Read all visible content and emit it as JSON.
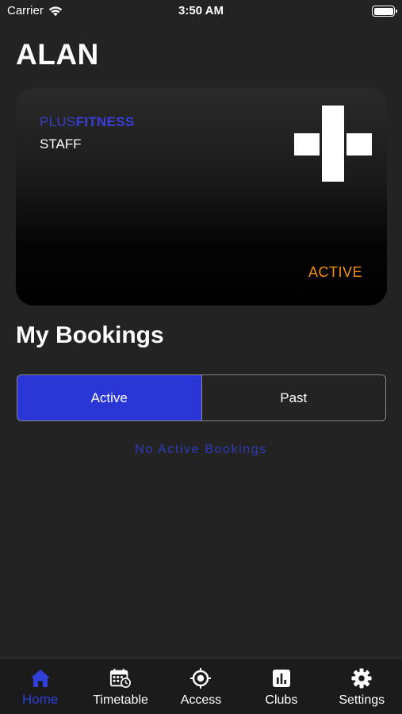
{
  "status_bar": {
    "carrier": "Carrier",
    "time": "3:50 AM"
  },
  "member": {
    "name": "ALAN"
  },
  "card": {
    "brand_plus": "PLUS",
    "brand_fitness": "FITNESS",
    "member_type": "STAFF",
    "status": "ACTIVE",
    "logo_icon": "plus-icon"
  },
  "bookings": {
    "title": "My Bookings",
    "tabs": [
      {
        "label": "Active",
        "selected": true
      },
      {
        "label": "Past",
        "selected": false
      }
    ],
    "empty_message": "No Active Bookings"
  },
  "tab_bar": {
    "items": [
      {
        "label": "Home",
        "icon": "home-icon",
        "selected": true
      },
      {
        "label": "Timetable",
        "icon": "calendar-icon",
        "selected": false
      },
      {
        "label": "Access",
        "icon": "target-icon",
        "selected": false
      },
      {
        "label": "Clubs",
        "icon": "chart-icon",
        "selected": false
      },
      {
        "label": "Settings",
        "icon": "gear-icon",
        "selected": false
      }
    ]
  },
  "colors": {
    "accent": "#2a37d6",
    "active_status": "#f0900c",
    "background": "#232323"
  }
}
